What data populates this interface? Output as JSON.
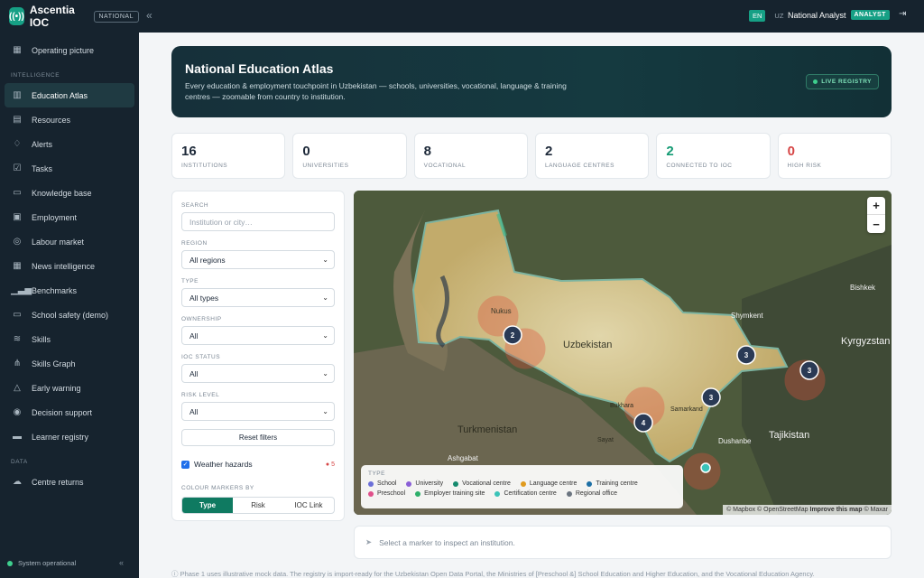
{
  "brand": {
    "name": "Ascentia IOC",
    "badge": "NATIONAL",
    "logo_glyph": "((•))"
  },
  "topbar": {
    "lang_en": "EN",
    "lang_uz": "UZ",
    "user": "National Analyst",
    "role": "ANALYST"
  },
  "nav": {
    "top": [
      {
        "label": "Operating picture",
        "icon": "gauge-icon"
      }
    ],
    "intelligence_label": "INTELLIGENCE",
    "intelligence": [
      {
        "label": "Education Atlas",
        "icon": "map-icon",
        "active": true
      },
      {
        "label": "Resources",
        "icon": "resources-icon"
      },
      {
        "label": "Alerts",
        "icon": "bell-icon"
      },
      {
        "label": "Tasks",
        "icon": "checkbox-icon"
      },
      {
        "label": "Knowledge base",
        "icon": "book-icon"
      },
      {
        "label": "Employment",
        "icon": "briefcase-icon"
      },
      {
        "label": "Labour market",
        "icon": "globe-icon"
      },
      {
        "label": "News intelligence",
        "icon": "news-icon"
      },
      {
        "label": "Benchmarks",
        "icon": "bar-chart-icon"
      },
      {
        "label": "School safety (demo)",
        "icon": "camera-icon"
      },
      {
        "label": "Skills",
        "icon": "skills-icon"
      },
      {
        "label": "Skills Graph",
        "icon": "graph-icon"
      },
      {
        "label": "Early warning",
        "icon": "warning-icon"
      },
      {
        "label": "Decision support",
        "icon": "target-icon"
      },
      {
        "label": "Learner registry",
        "icon": "id-card-icon"
      }
    ],
    "data_label": "DATA",
    "data": [
      {
        "label": "Centre returns",
        "icon": "cloud-upload-icon"
      }
    ],
    "status": "System operational"
  },
  "hero": {
    "title": "National Education Atlas",
    "subtitle": "Every education & employment touchpoint in Uzbekistan — schools, universities, vocational, language & training centres — zoomable from country to institution.",
    "badge": "LIVE REGISTRY"
  },
  "stats": [
    {
      "value": "16",
      "label": "INSTITUTIONS",
      "tone": ""
    },
    {
      "value": "0",
      "label": "UNIVERSITIES",
      "tone": ""
    },
    {
      "value": "8",
      "label": "VOCATIONAL",
      "tone": ""
    },
    {
      "value": "2",
      "label": "LANGUAGE CENTRES",
      "tone": ""
    },
    {
      "value": "2",
      "label": "CONNECTED TO IOC",
      "tone": "green"
    },
    {
      "value": "0",
      "label": "HIGH RISK",
      "tone": "red"
    }
  ],
  "filters": {
    "search_label": "SEARCH",
    "search_placeholder": "Institution or city…",
    "region_label": "REGION",
    "region_value": "All regions",
    "type_label": "TYPE",
    "type_value": "All types",
    "ownership_label": "OWNERSHIP",
    "ownership_value": "All",
    "ioc_label": "IOC STATUS",
    "ioc_value": "All",
    "risk_label": "RISK LEVEL",
    "risk_value": "All",
    "reset": "Reset filters",
    "weather": "Weather hazards",
    "weather_count": "5",
    "colour_label": "COLOUR MARKERS BY",
    "colour_options": [
      "Type",
      "Risk",
      "IOC Link"
    ]
  },
  "map": {
    "places": [
      {
        "name": "Uzbekistan"
      },
      {
        "name": "Turkmenistan"
      },
      {
        "name": "Kyrgyzstan"
      },
      {
        "name": "Tajikistan"
      },
      {
        "name": "Shymkent"
      },
      {
        "name": "Bishkek"
      },
      {
        "name": "Nukus"
      },
      {
        "name": "Samarkand"
      },
      {
        "name": "Bukhara"
      },
      {
        "name": "Dushanbe"
      },
      {
        "name": "Ashgabat"
      },
      {
        "name": "Sayat"
      }
    ],
    "clusters": [
      "2",
      "3",
      "3",
      "3",
      "4"
    ],
    "legend_title": "TYPE",
    "legend": [
      {
        "label": "School",
        "color": "#6b6fd8"
      },
      {
        "label": "University",
        "color": "#8a5fd6"
      },
      {
        "label": "Vocational centre",
        "color": "#168a6e"
      },
      {
        "label": "Language centre",
        "color": "#e09b1e"
      },
      {
        "label": "Training centre",
        "color": "#1d6fa5"
      },
      {
        "label": "Preschool",
        "color": "#e0508a"
      },
      {
        "label": "Employer training site",
        "color": "#2eaf6a"
      },
      {
        "label": "Certification centre",
        "color": "#3bc3b8"
      },
      {
        "label": "Regional office",
        "color": "#6b7580"
      }
    ],
    "attribution_a": "© Mapbox © OpenStreetMap",
    "attribution_b": "Improve this map",
    "attribution_c": "© Maxar",
    "zoom_in": "+",
    "zoom_out": "−"
  },
  "inspect": "Select a marker to inspect an institution.",
  "footnote": "ⓘ Phase 1 uses illustrative mock data. The registry is import-ready for the Uzbekistan Open Data Portal, the Ministries of [Preschool &] School Education and Higher Education, and the Vocational Education Agency."
}
